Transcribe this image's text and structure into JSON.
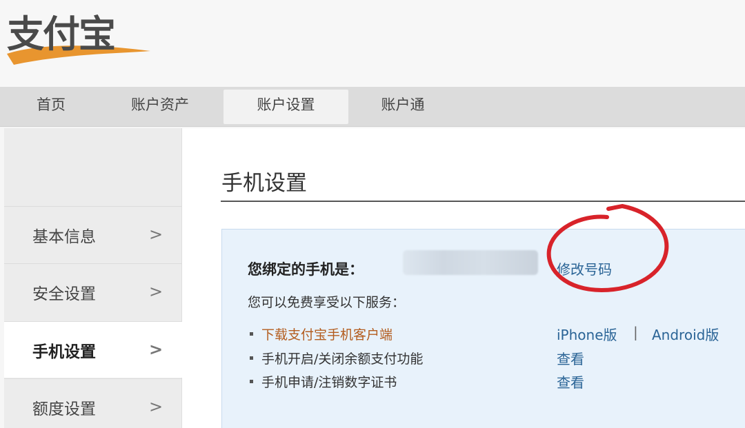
{
  "logo": {
    "text": "支付宝"
  },
  "nav": {
    "items": [
      {
        "label": "首页"
      },
      {
        "label": "账户资产"
      },
      {
        "label": "账户设置"
      },
      {
        "label": "账户通"
      }
    ]
  },
  "sidebar": {
    "items": [
      {
        "label": "基本信息"
      },
      {
        "label": "安全设置"
      },
      {
        "label": "手机设置"
      },
      {
        "label": "额度设置"
      }
    ],
    "chevron": ">"
  },
  "main": {
    "title": "手机设置",
    "bound_label": "您绑定的手机是：",
    "change_number": "修改号码",
    "services_intro": "您可以免费享受以下服务：",
    "services": [
      {
        "text": "下载支付宝手机客户端",
        "link_iphone": "iPhone版",
        "separator": "|",
        "link_android": "Android版"
      },
      {
        "text": "手机开启/关闭余额支付功能",
        "link": "查看"
      },
      {
        "text": "手机申请/注销数字证书",
        "link": "查看"
      }
    ]
  },
  "colors": {
    "link": "#2a6496",
    "download_text": "#b35c1e",
    "highlight_circle": "#d8232a",
    "logo_swoosh": "#e8952f"
  }
}
